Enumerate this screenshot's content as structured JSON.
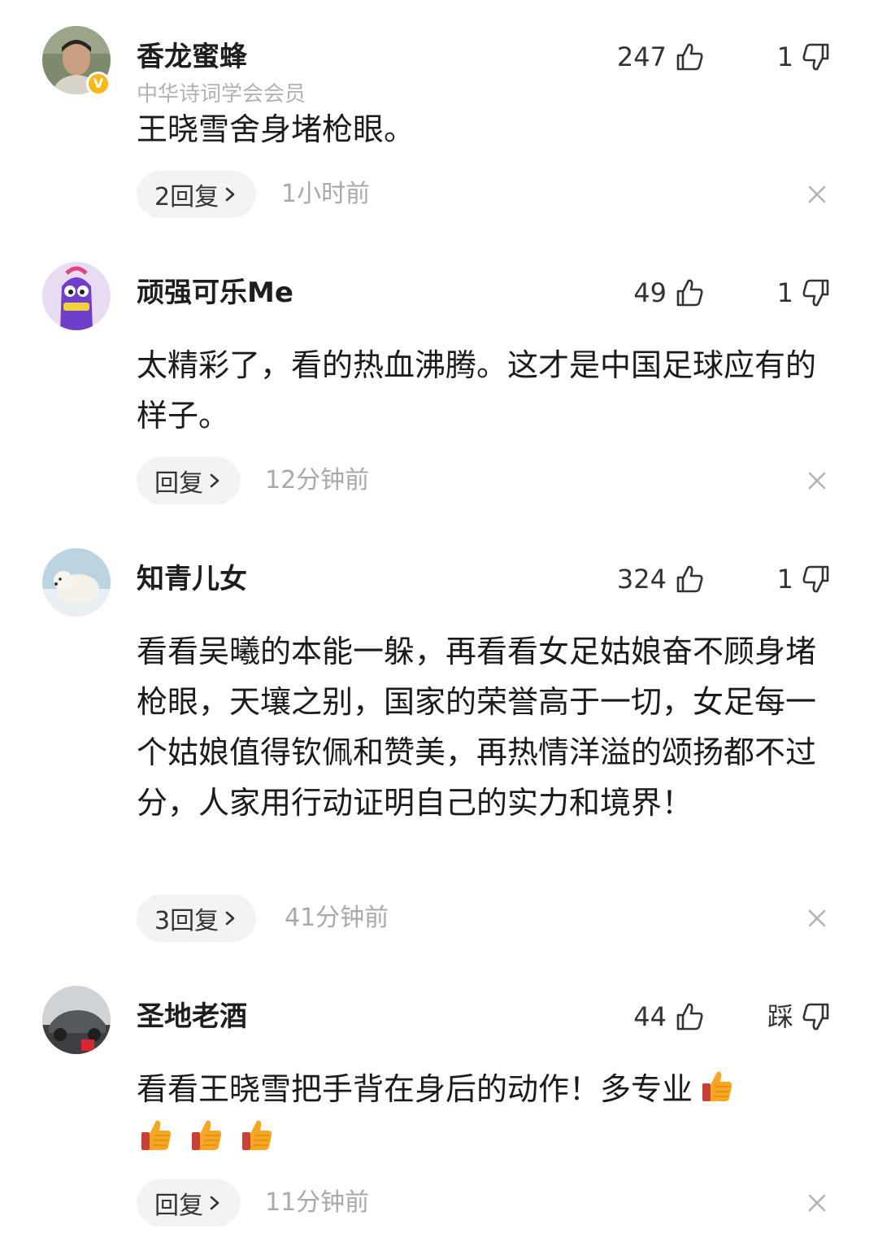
{
  "comments": [
    {
      "username": "香龙蜜蜂",
      "subtitle": "中华诗词学会会员",
      "verified": true,
      "like_count": "247",
      "dislike_label": "1",
      "text": "王晓雪舍身堵枪眼。",
      "reply_label": "2回复",
      "time": "1小时前",
      "avatar_icon": "man-portrait-avatar"
    },
    {
      "username": "顽强可乐Me",
      "like_count": "49",
      "dislike_label": "1",
      "text": "太精彩了，看的热血沸腾。这才是中国足球应有的样子。",
      "reply_label": "回复",
      "time": "12分钟前",
      "avatar_icon": "purple-cartoon-avatar"
    },
    {
      "username": "知青儿女",
      "like_count": "324",
      "dislike_label": "1",
      "text": "看看吴曦的本能一躲，再看看女足姑娘奋不顾身堵枪眼，天壤之别，国家的荣誉高于一切，女足每一个姑娘值得钦佩和赞美，再热情洋溢的颂扬都不过分，人家用行动证明自己的实力和境界！",
      "reply_label": "3回复",
      "time": "41分钟前",
      "avatar_icon": "polar-bear-avatar"
    },
    {
      "username": "圣地老酒",
      "like_count": "44",
      "dislike_label": "踩",
      "text": "看看王晓雪把手背在身后的动作！多专业",
      "emoji_icons": [
        "thumbs-up-emoji",
        "thumbs-up-emoji",
        "thumbs-up-emoji",
        "thumbs-up-emoji"
      ],
      "reply_label": "回复",
      "time": "11分钟前",
      "avatar_icon": "car-photo-avatar"
    }
  ],
  "colors": {
    "username": "#1e1e1e",
    "muted": "#a9a9a9",
    "pill_bg": "#f3f3f3",
    "verified": "#f5b91a",
    "emoji_orange": "#f5a623"
  }
}
